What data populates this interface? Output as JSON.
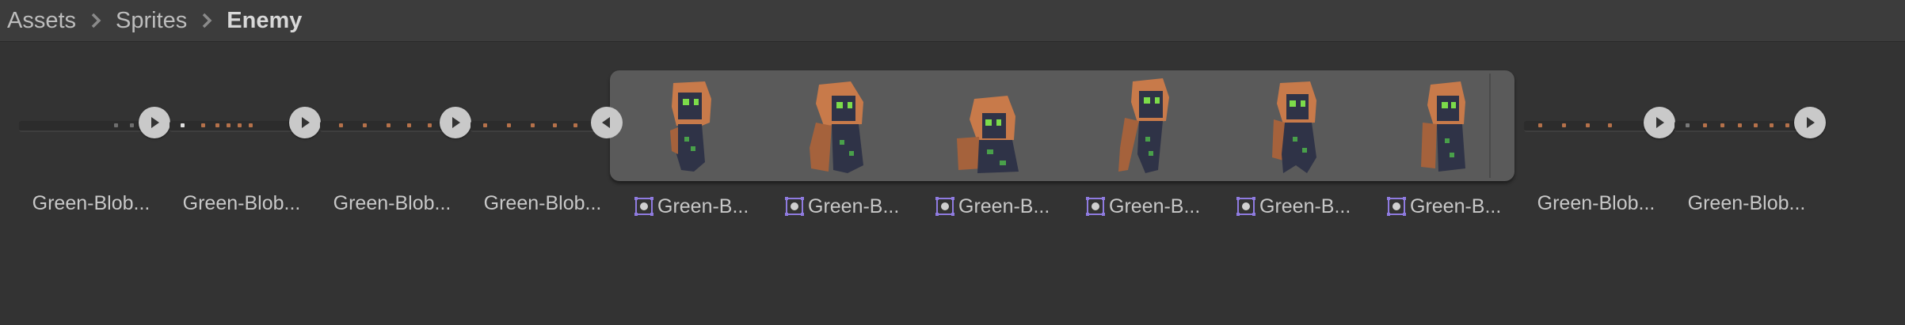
{
  "breadcrumb": {
    "items": [
      "Assets",
      "Sprites",
      "Enemy"
    ]
  },
  "assets": [
    {
      "label": "Green-Blob..."
    },
    {
      "label": "Green-Blob..."
    },
    {
      "label": "Green-Blob..."
    },
    {
      "label": "Green-Blob..."
    },
    {
      "label": "Green-Blob..."
    },
    {
      "label": "Green-Blob..."
    }
  ],
  "expanded_frames": [
    {
      "label": "Green-B..."
    },
    {
      "label": "Green-B..."
    },
    {
      "label": "Green-B..."
    },
    {
      "label": "Green-B..."
    },
    {
      "label": "Green-B..."
    },
    {
      "label": "Green-B..."
    }
  ],
  "colors": {
    "background": "#333333",
    "toolbar": "#3c3c3c",
    "expanded_panel": "#5a5a5a",
    "sprite_icon_accent": "#8f7be0",
    "hood_orange": "#c87a4a",
    "body_dark": "#2f3347",
    "eye_green": "#7cdc4a"
  },
  "icons": {
    "breadcrumb_separator": "chevron-right-icon",
    "play": "play-icon",
    "collapse": "collapse-left-icon",
    "sprite": "sprite-icon"
  }
}
